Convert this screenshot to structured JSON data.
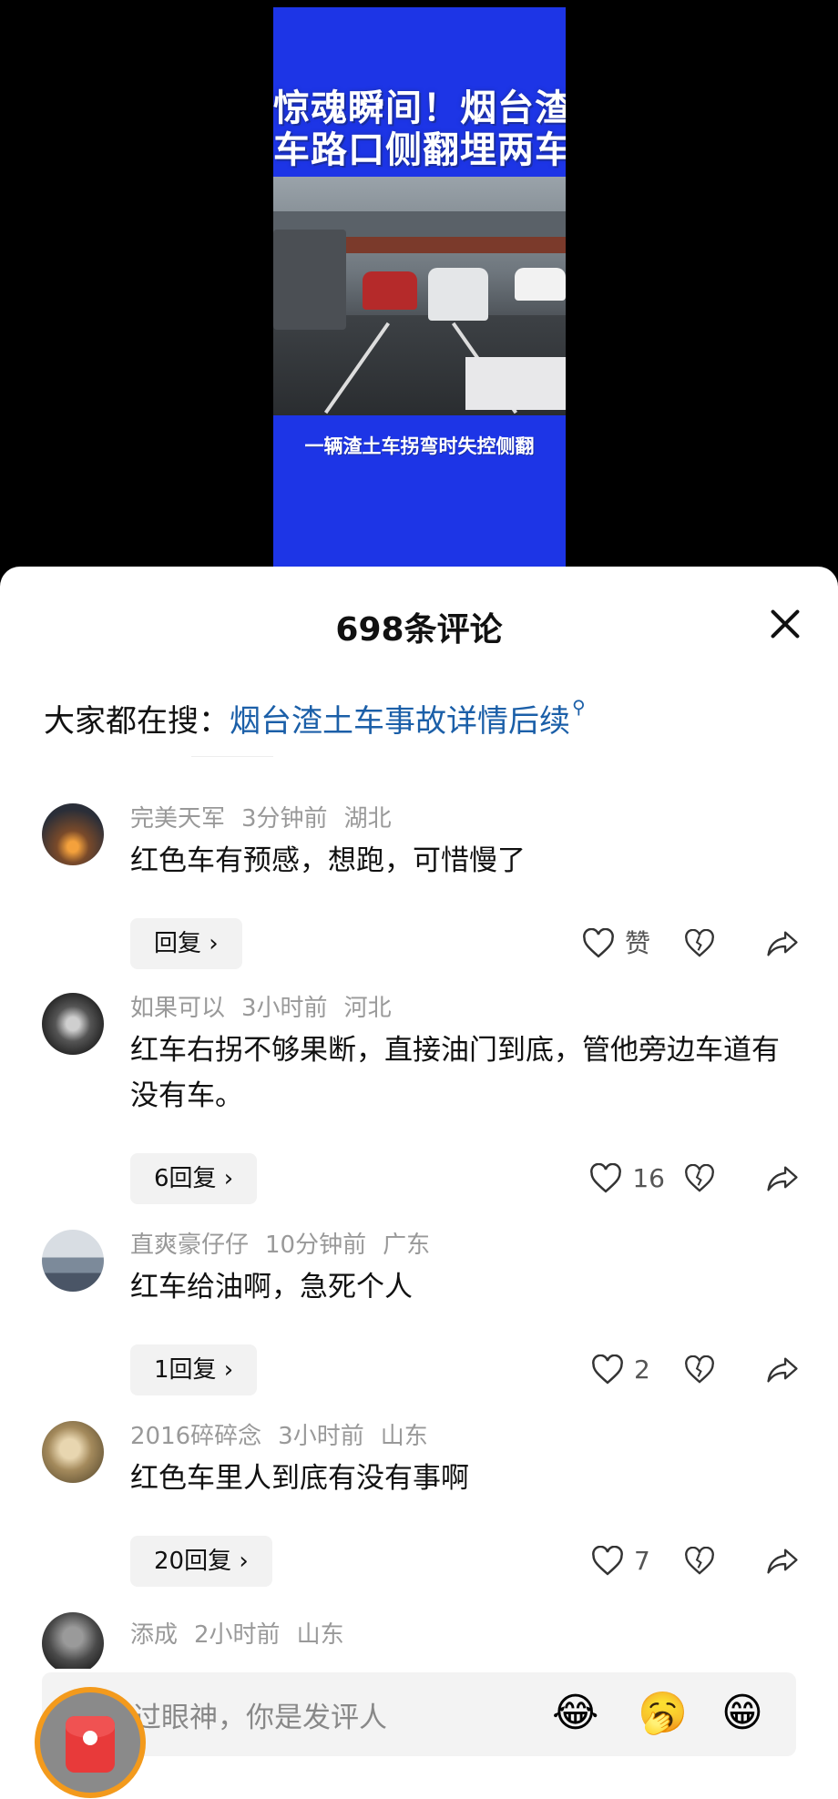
{
  "video": {
    "title_line1": "惊魂瞬间！烟台渣土",
    "title_line2": "车路口侧翻埋两车",
    "caption": "一辆渣土车拐弯时失控侧翻"
  },
  "sheet": {
    "title": "698条评论",
    "search_prefix": "大家都在搜：",
    "search_link": "烟台渣土车事故详情后续"
  },
  "comments": [
    {
      "user": "完美天军",
      "time": "3分钟前",
      "region": "湖北",
      "text": "红色车有预感，想跑，可惜慢了",
      "reply": "回复",
      "likes": "赞"
    },
    {
      "user": "如果可以",
      "time": "3小时前",
      "region": "河北",
      "text": "红车右拐不够果断，直接油门到底，管他旁边车道有没有车。",
      "reply": "6回复",
      "likes": "16"
    },
    {
      "user": "直爽豪仔仔",
      "time": "10分钟前",
      "region": "广东",
      "text": "红车给油啊，急死个人",
      "reply": "1回复",
      "likes": "2"
    },
    {
      "user": "2016碎碎念",
      "time": "3小时前",
      "region": "山东",
      "text": "红色车里人到底有没有事啊",
      "reply": "20回复",
      "likes": "7"
    },
    {
      "user": "添成",
      "time": "2小时前",
      "region": "山东"
    }
  ],
  "input": {
    "placeholder": "确认过眼神，你是发评人"
  },
  "emojis": [
    "😂",
    "🥱",
    "😁"
  ],
  "colors": {
    "video_bg": "#1d35e6",
    "link": "#1b5fa8",
    "redpack": "#e83a3a",
    "ring": "#f39a1c"
  }
}
